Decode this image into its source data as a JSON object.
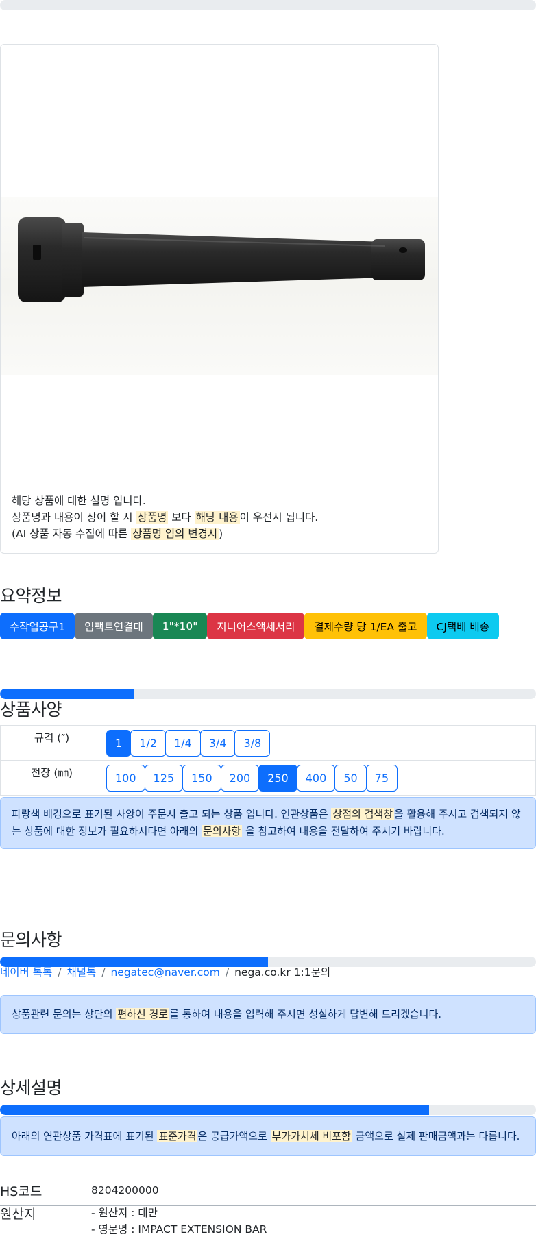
{
  "card": {
    "desc_line1": "해당 상품에 대한 설명 입니다.",
    "desc_line2_a": "상품명과 내용이 상이 할 시 ",
    "desc_line2_hl1": "상품명",
    "desc_line2_b": " 보다 ",
    "desc_line2_hl2": "해당 내용",
    "desc_line2_c": "이 우선시 됩니다.",
    "desc_line3_a": "(AI 상품 자동 수집에 따른 ",
    "desc_line3_hl": "상품명 임의 변경시",
    "desc_line3_b": ")"
  },
  "summary": {
    "title": "요약정보",
    "badges": [
      "수작업공구1",
      "임팩트연결대",
      "1\"*10\"",
      "지니어스액세서리",
      "결제수량 당 1/EA 출고",
      "CJ택배 배송"
    ]
  },
  "spec": {
    "progress": 0.25,
    "title": "상품사양",
    "rows": [
      {
        "label": "규격 (″)",
        "options": [
          "1",
          "1/2",
          "1/4",
          "3/4",
          "3/8"
        ],
        "selected": "1"
      },
      {
        "label": "전장 (㎜)",
        "options": [
          "100",
          "125",
          "150",
          "200",
          "250",
          "400",
          "50",
          "75"
        ],
        "selected": "250"
      }
    ],
    "notice_a": "파랑색 배경으로 표기된 사양이 주문시 출고 되는 상품 입니다. 연관상품은 ",
    "notice_hl1": "상점의 검색창",
    "notice_b": "을 활용해 주시고 검색되지 않는 상품에 대한 정보가 필요하시다면 아래의 ",
    "notice_hl2": "문의사항",
    "notice_c": " 을 참고하여 내용을 전달하여 주시기 바랍니다."
  },
  "inquiry": {
    "title": "문의사항",
    "progress": 0.5,
    "links": [
      "네이버 톡톡",
      "채널톡",
      "negatec@naver.com"
    ],
    "plain": "nega.co.kr 1:1문의",
    "notice_a": "상품관련 문의는 상단의 ",
    "notice_hl": "편하신 경로",
    "notice_b": "를 통하여 내용을 입력해 주시면 성실하게 답변해 드리겠습니다."
  },
  "detail": {
    "title": "상세설명",
    "progress": 0.8,
    "notice_a": "아래의 연관상품 가격표에 표기된 ",
    "notice_hl1": "표준가격",
    "notice_b": "은 공급가액으로 ",
    "notice_hl2": "부가가치세 비포함",
    "notice_c": " 금액으로 실제 판매금액과는 다릅니다.",
    "hs_label": "HS코드",
    "hs_value": "8204200000",
    "origin_label": "원산지",
    "origin_line1": "- 원산지 : 대만",
    "origin_line2": "- 영문명 : IMPACT EXTENSION BAR"
  },
  "colors": {
    "primary": "#0d6efd",
    "alert_bg": "#cfe2ff",
    "highlight": "#fff3cd"
  }
}
